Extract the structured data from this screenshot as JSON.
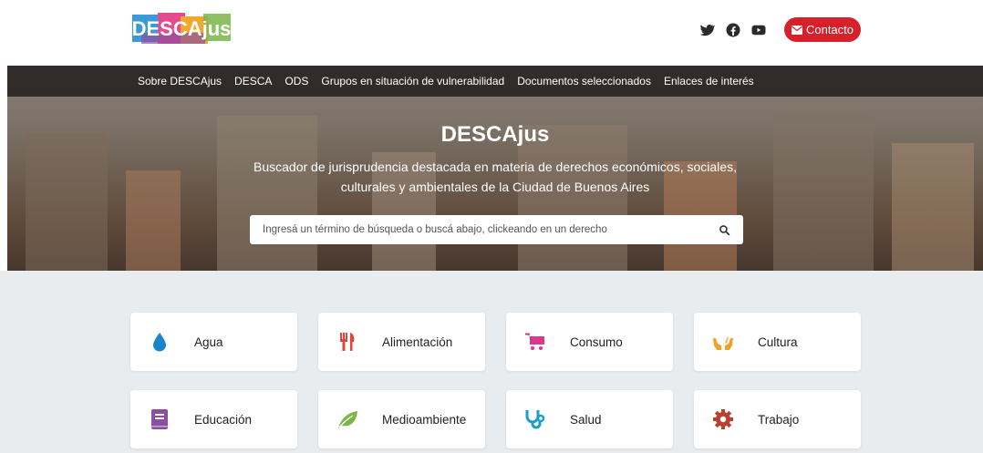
{
  "header": {
    "logo_text": "DESCAjus",
    "social": [
      "twitter-icon",
      "facebook-icon",
      "youtube-icon"
    ],
    "contact_label": "Contacto",
    "contact_color": "#d6202a"
  },
  "nav": {
    "items": [
      "Sobre DESCAjus",
      "DESCA",
      "ODS",
      "Grupos en situación de vulnerabilidad",
      "Documentos seleccionados",
      "Enlaces de interés"
    ]
  },
  "hero": {
    "title": "DESCAjus",
    "subtitle": "Buscador de jurisprudencia destacada en materia de derechos económicos, sociales, culturales y ambientales de la Ciudad de Buenos Aires"
  },
  "search": {
    "placeholder": "Ingresá un término de búsqueda o buscá abajo, clickeando en un derecho",
    "value": ""
  },
  "categories": [
    {
      "label": "Agua",
      "icon": "water-drop-icon",
      "color": "#1a86c7"
    },
    {
      "label": "Alimentación",
      "icon": "cutlery-icon",
      "color": "#e2463b"
    },
    {
      "label": "Consumo",
      "icon": "cart-icon",
      "color": "#d9388f"
    },
    {
      "label": "Cultura",
      "icon": "hands-icon",
      "color": "#e9a526"
    },
    {
      "label": "Educación",
      "icon": "book-icon",
      "color": "#8c4ea0"
    },
    {
      "label": "Medioambiente",
      "icon": "leaf-icon",
      "color": "#7ab648"
    },
    {
      "label": "Salud",
      "icon": "stethoscope-icon",
      "color": "#1aa1c9"
    },
    {
      "label": "Trabajo",
      "icon": "gear-icon",
      "color": "#b9422f"
    }
  ]
}
